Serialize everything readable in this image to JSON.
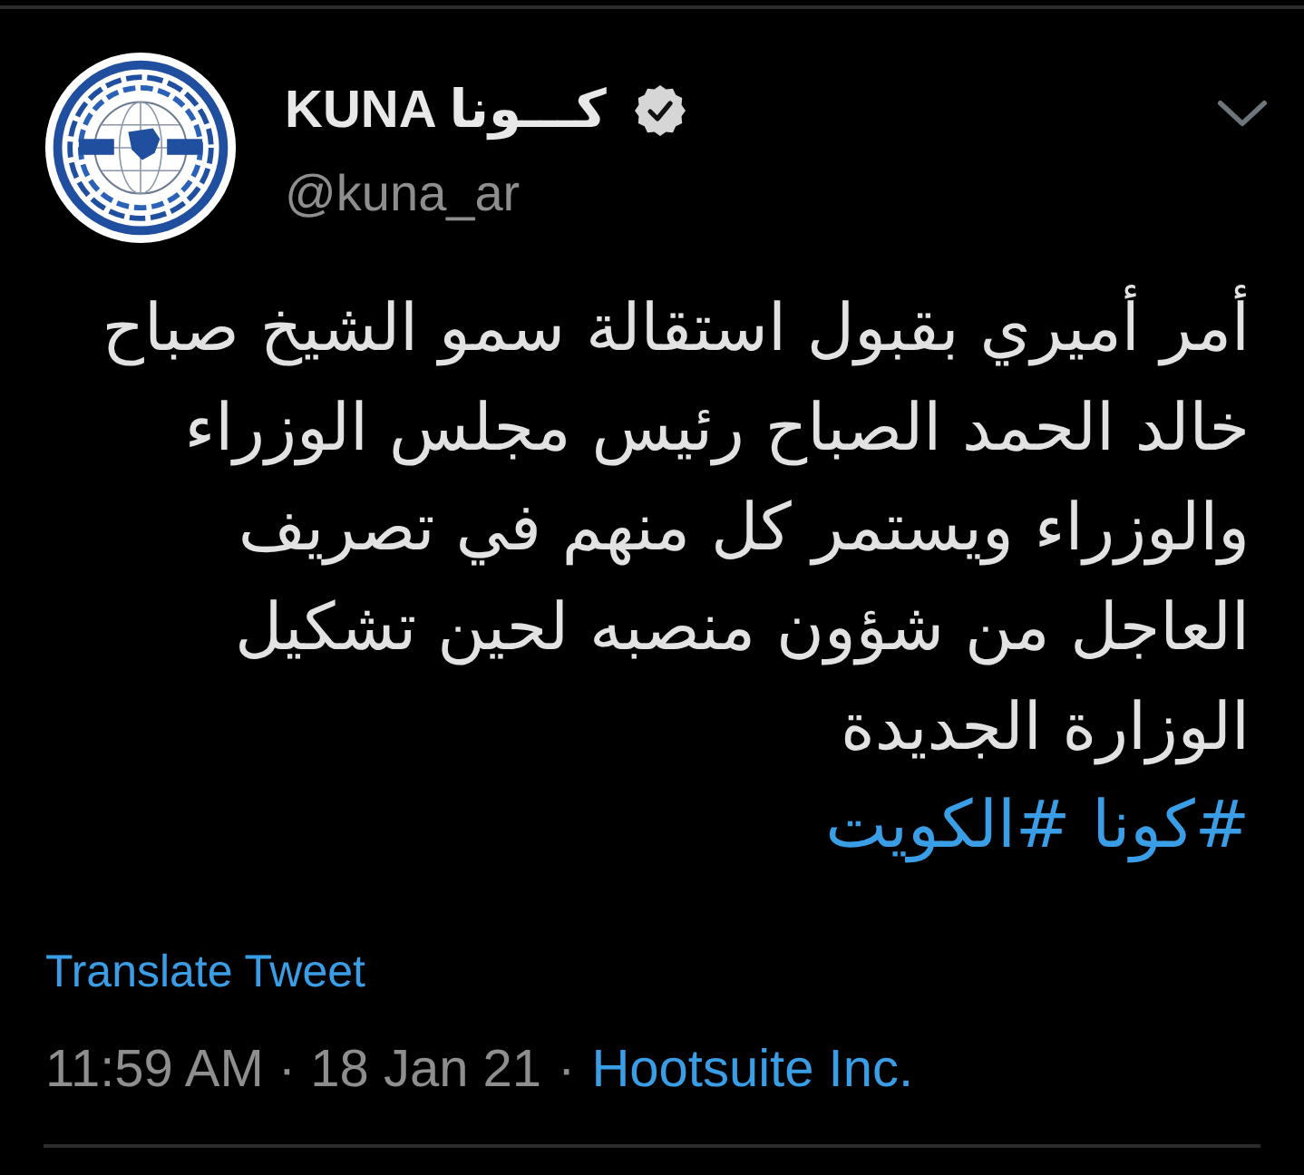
{
  "author": {
    "name": "KUNA كـــونا",
    "verified": true,
    "handle": "@kuna_ar"
  },
  "body": "أمر أميري بقبول استقالة سمو الشيخ صباح خالد الحمد الصباح رئيس مجلس الوزراء والوزراء ويستمر كل منهم في تصريف العاجل من شؤون منصبه لحين تشكيل الوزارة الجديدة",
  "hashtags": [
    "#كونا",
    "#الكويت"
  ],
  "translate": "Translate Tweet",
  "meta": {
    "timestamp": "11:59 AM · 18 Jan 21",
    "separator": "·",
    "source": "Hootsuite Inc."
  }
}
